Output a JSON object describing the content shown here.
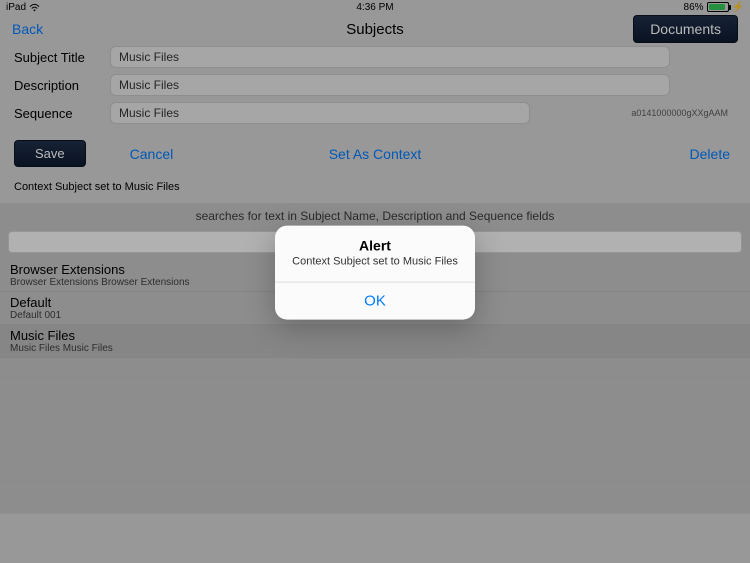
{
  "statusbar": {
    "device": "iPad",
    "time": "4:36 PM",
    "battery_pct": "86%"
  },
  "navbar": {
    "back": "Back",
    "title": "Subjects",
    "documents": "Documents"
  },
  "form": {
    "subject_title_label": "Subject Title",
    "subject_title_value": "Music Files",
    "description_label": "Description",
    "description_value": "Music Files",
    "sequence_label": "Sequence",
    "sequence_value": "Music Files",
    "sequence_id": "a0141000000gXXgAAM"
  },
  "actions": {
    "save": "Save",
    "cancel": "Cancel",
    "set_context": "Set As Context",
    "delete": "Delete"
  },
  "status": "Context Subject set to Music Files",
  "search": {
    "hint": "searches for text in Subject Name, Description and Sequence fields"
  },
  "list": [
    {
      "title": "Browser Extensions",
      "sub": "Browser Extensions Browser Extensions",
      "selected": false
    },
    {
      "title": "Default",
      "sub": "Default 001",
      "selected": false
    },
    {
      "title": "Music Files",
      "sub": "Music Files Music Files",
      "selected": true
    }
  ],
  "alert": {
    "title": "Alert",
    "message": "Context Subject set to Music Files",
    "ok": "OK"
  }
}
